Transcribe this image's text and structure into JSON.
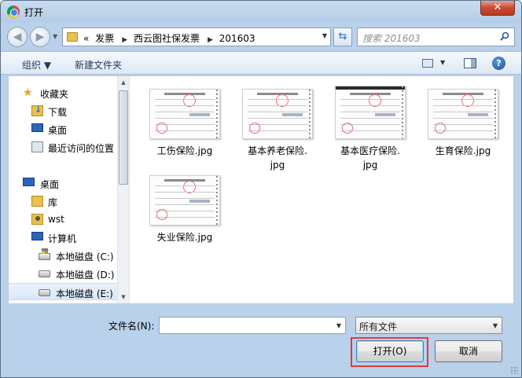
{
  "titlebar": {
    "title": "打开",
    "close_label": "✕"
  },
  "address": {
    "overflow": "«",
    "crumbs": [
      "发票",
      "西云图社保发票",
      "201603"
    ],
    "search_placeholder": "搜索 201603"
  },
  "commandbar": {
    "organize": "组织 ▼",
    "new_folder": "新建文件夹"
  },
  "sidebar": {
    "favorites": "收藏夹",
    "downloads": "下载",
    "desktop_fav": "桌面",
    "recent": "最近访问的位置",
    "desktop": "桌面",
    "library": "库",
    "user": "wst",
    "computer": "计算机",
    "drive_c": "本地磁盘 (C:)",
    "drive_d": "本地磁盘 (D:)",
    "drive_e": "本地磁盘 (E:)"
  },
  "files": [
    {
      "name": "工伤保险.jpg"
    },
    {
      "name": "基本养老保险.jpg",
      "line1": "基本养老保险.",
      "line2": "jpg"
    },
    {
      "name": "基本医疗保险.jpg",
      "line1": "基本医疗保险.",
      "line2": "jpg"
    },
    {
      "name": "生育保险.jpg"
    },
    {
      "name": "失业保险.jpg"
    }
  ],
  "bottom": {
    "filename_label": "文件名(N):",
    "filename_value": "",
    "filetype_value": "所有文件",
    "open_label": "打开(O)",
    "cancel_label": "取消"
  }
}
